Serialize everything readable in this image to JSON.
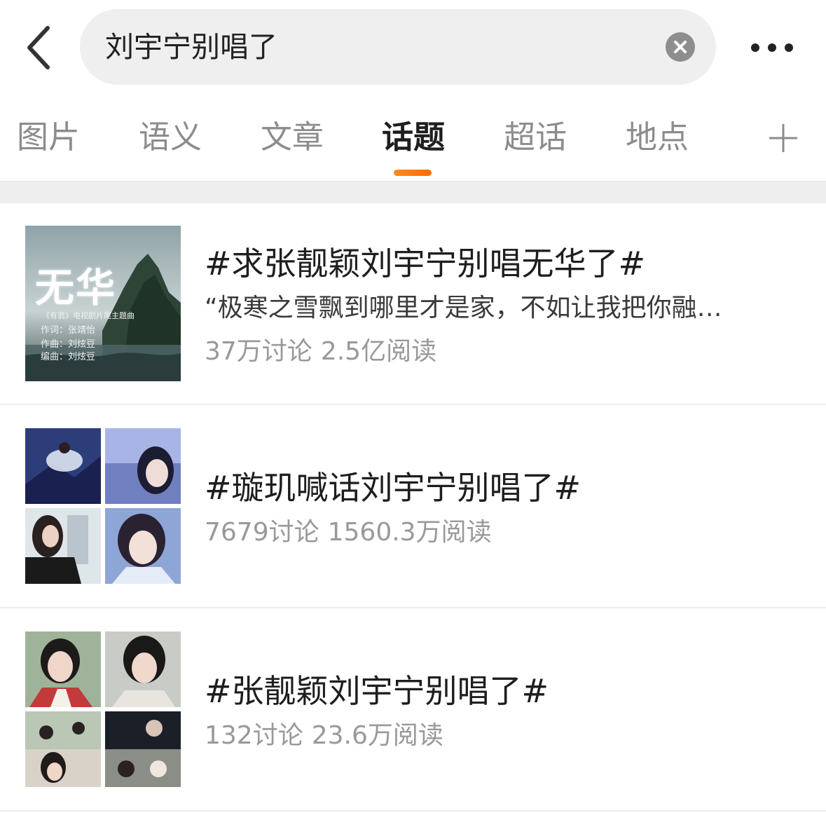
{
  "search": {
    "query": "刘宇宁别唱了"
  },
  "icons": {
    "back": "chevron-left-icon",
    "clear": "close-circle-icon",
    "more": "more-dots-icon",
    "add": "plus-icon"
  },
  "tabs": [
    {
      "label": "图片",
      "active": false
    },
    {
      "label": "语义",
      "active": false
    },
    {
      "label": "文章",
      "active": false
    },
    {
      "label": "话题",
      "active": true
    },
    {
      "label": "超话",
      "active": false
    },
    {
      "label": "地点",
      "active": false
    }
  ],
  "colors": {
    "accent": "#ff7a00",
    "search_bg": "#efefef",
    "active_tab": "#1f1f1f",
    "inactive_tab": "#8c8c8c",
    "stats": "#999999"
  },
  "results": [
    {
      "title": "#求张靓颖刘宇宁别唱无华了#",
      "desc": "“极寒之雪飘到哪里才是家，不如让我把你融…",
      "discussions": "37万讨论",
      "reads": "2.5亿阅读",
      "poster": {
        "title": "无华",
        "line1": "《有翡》电视剧片尾主题曲",
        "line2": "作词：张靖怡",
        "line3": "作曲：刘炫豆",
        "line4": "编曲：刘炫豆"
      }
    },
    {
      "title": "#璇玑喊话刘宇宁别唱了#",
      "discussions": "7679讨论",
      "reads": "1560.3万阅读"
    },
    {
      "title": "#张靓颖刘宇宁别唱了#",
      "discussions": "132讨论",
      "reads": "23.6万阅读"
    }
  ]
}
